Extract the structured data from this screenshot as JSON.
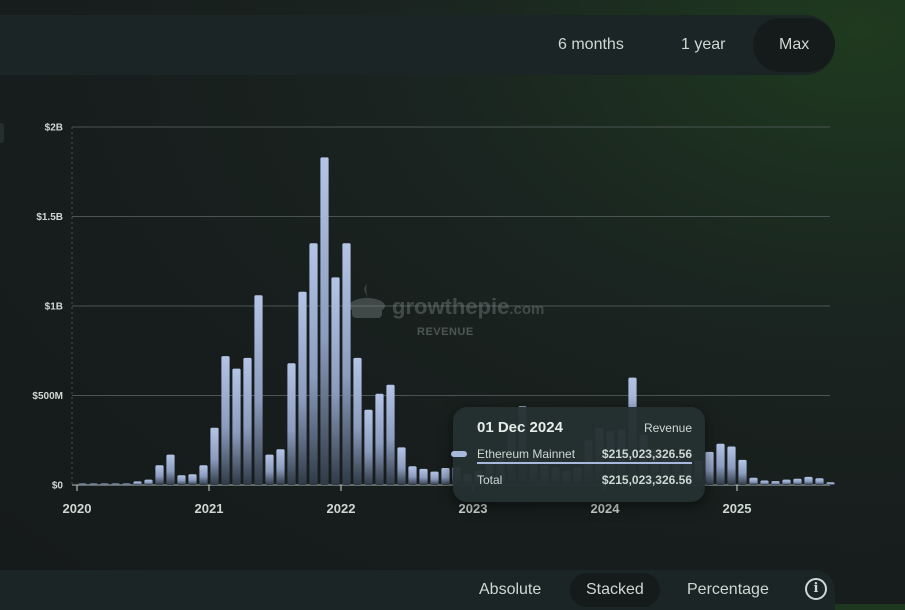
{
  "range_buttons": [
    {
      "label": "6 months",
      "active": false
    },
    {
      "label": "1 year",
      "active": false
    },
    {
      "label": "Max",
      "active": true
    }
  ],
  "watermark": {
    "brand": "growthepie",
    "domain": ".com",
    "metric": "REVENUE"
  },
  "tooltip": {
    "date": "01 Dec 2024",
    "metric": "Revenue",
    "rows": [
      {
        "name": "Ethereum Mainnet",
        "value": "$215,023,326.56"
      },
      {
        "name": "Total",
        "value": "$215,023,326.56"
      }
    ]
  },
  "mode_buttons": [
    {
      "label": "Absolute",
      "active": false
    },
    {
      "label": "Stacked",
      "active": true
    },
    {
      "label": "Percentage",
      "active": false
    }
  ],
  "info_icon": "info-icon",
  "colors": {
    "bar": "#a7b8dc",
    "grid": "#4a5553",
    "text": "#cdd8d3"
  },
  "chart_data": {
    "type": "bar",
    "y_ticks": [
      "$0",
      "$500M",
      "$1B",
      "$1.5B",
      "$2B"
    ],
    "y_tick_values": [
      0,
      500,
      1000,
      1500,
      2000
    ],
    "y_unit": "millions USD",
    "ylim": [
      0,
      2000
    ],
    "x_ticks": [
      "2020",
      "2021",
      "2022",
      "2023",
      "2024",
      "2025"
    ],
    "x_range": [
      "2020-01",
      "2025-09"
    ],
    "stacked": true,
    "series": [
      {
        "name": "Ethereum Mainnet",
        "values": [
          {
            "month": "2020-01",
            "v": 2
          },
          {
            "month": "2020-02",
            "v": 3
          },
          {
            "month": "2020-03",
            "v": 5
          },
          {
            "month": "2020-04",
            "v": 4
          },
          {
            "month": "2020-05",
            "v": 8
          },
          {
            "month": "2020-06",
            "v": 20
          },
          {
            "month": "2020-07",
            "v": 30
          },
          {
            "month": "2020-08",
            "v": 110
          },
          {
            "month": "2020-09",
            "v": 170
          },
          {
            "month": "2020-10",
            "v": 55
          },
          {
            "month": "2020-11",
            "v": 60
          },
          {
            "month": "2020-12",
            "v": 110
          },
          {
            "month": "2021-01",
            "v": 320
          },
          {
            "month": "2021-02",
            "v": 720
          },
          {
            "month": "2021-03",
            "v": 650
          },
          {
            "month": "2021-04",
            "v": 710
          },
          {
            "month": "2021-05",
            "v": 1060
          },
          {
            "month": "2021-06",
            "v": 170
          },
          {
            "month": "2021-07",
            "v": 200
          },
          {
            "month": "2021-08",
            "v": 680
          },
          {
            "month": "2021-09",
            "v": 1080
          },
          {
            "month": "2021-10",
            "v": 1350
          },
          {
            "month": "2021-11",
            "v": 1830
          },
          {
            "month": "2021-12",
            "v": 1160
          },
          {
            "month": "2022-01",
            "v": 1350
          },
          {
            "month": "2022-02",
            "v": 710
          },
          {
            "month": "2022-03",
            "v": 420
          },
          {
            "month": "2022-04",
            "v": 510
          },
          {
            "month": "2022-05",
            "v": 560
          },
          {
            "month": "2022-06",
            "v": 210
          },
          {
            "month": "2022-07",
            "v": 105
          },
          {
            "month": "2022-08",
            "v": 90
          },
          {
            "month": "2022-09",
            "v": 75
          },
          {
            "month": "2022-10",
            "v": 95
          },
          {
            "month": "2022-11",
            "v": 100
          },
          {
            "month": "2022-12",
            "v": 60
          },
          {
            "month": "2023-01",
            "v": 80
          },
          {
            "month": "2023-02",
            "v": 120
          },
          {
            "month": "2023-03",
            "v": 150
          },
          {
            "month": "2023-04",
            "v": 350
          },
          {
            "month": "2023-05",
            "v": 440
          },
          {
            "month": "2023-06",
            "v": 150
          },
          {
            "month": "2023-07",
            "v": 110
          },
          {
            "month": "2023-08",
            "v": 100
          },
          {
            "month": "2023-09",
            "v": 80
          },
          {
            "month": "2023-10",
            "v": 100
          },
          {
            "month": "2023-11",
            "v": 250
          },
          {
            "month": "2023-12",
            "v": 320
          },
          {
            "month": "2024-01",
            "v": 300
          },
          {
            "month": "2024-02",
            "v": 310
          },
          {
            "month": "2024-03",
            "v": 600
          },
          {
            "month": "2024-04",
            "v": 280
          },
          {
            "month": "2024-05",
            "v": 200
          },
          {
            "month": "2024-06",
            "v": 160
          },
          {
            "month": "2024-07",
            "v": 150
          },
          {
            "month": "2024-08",
            "v": 130
          },
          {
            "month": "2024-09",
            "v": 135
          },
          {
            "month": "2024-10",
            "v": 185
          },
          {
            "month": "2024-11",
            "v": 230
          },
          {
            "month": "2024-12",
            "v": 215
          },
          {
            "month": "2025-01",
            "v": 140
          },
          {
            "month": "2025-02",
            "v": 40
          },
          {
            "month": "2025-03",
            "v": 25
          },
          {
            "month": "2025-04",
            "v": 22
          },
          {
            "month": "2025-05",
            "v": 30
          },
          {
            "month": "2025-06",
            "v": 35
          },
          {
            "month": "2025-07",
            "v": 45
          },
          {
            "month": "2025-08",
            "v": 38
          },
          {
            "month": "2025-09",
            "v": 15
          }
        ]
      }
    ],
    "hovered": {
      "month": "2024-12",
      "value": 215.02
    }
  }
}
